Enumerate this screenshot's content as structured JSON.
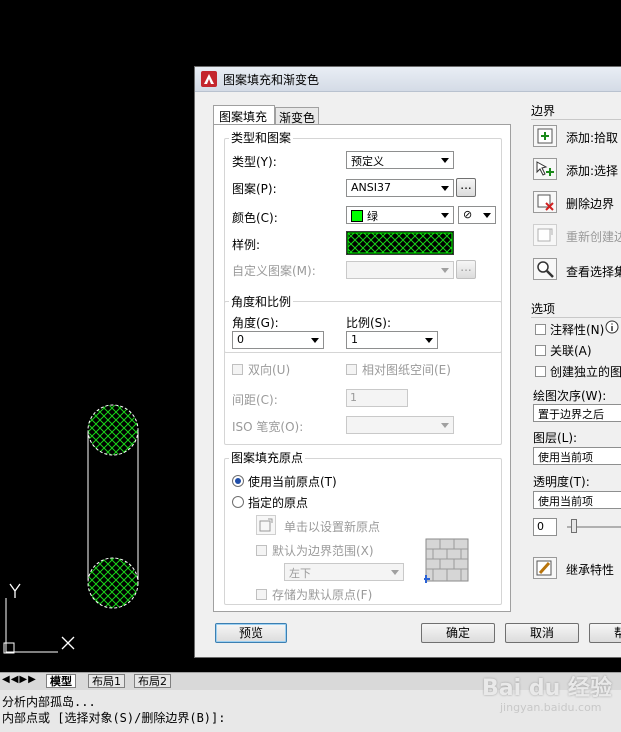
{
  "dialog": {
    "title": "图案填充和渐变色",
    "tabs": [
      "图案填充",
      "渐变色"
    ],
    "type_pattern": {
      "title": "类型和图案",
      "type_label": "类型(Y):",
      "type_value": "预定义",
      "pattern_label": "图案(P):",
      "pattern_value": "ANSI37",
      "browse": "...",
      "color_label": "颜色(C):",
      "color_value": "绿",
      "color_swatch": "#00ff00",
      "bgcolor_value": "⊘",
      "swatch_label": "样例:",
      "custom_label": "自定义图案(M):"
    },
    "angle_scale": {
      "title": "角度和比例",
      "angle_label": "角度(G):",
      "angle_value": "0",
      "scale_label": "比例(S):",
      "scale_value": "1",
      "double_label": "双向(U)",
      "relative_label": "相对图纸空间(E)",
      "spacing_label": "间距(C):",
      "spacing_value": "1",
      "iso_label": "ISO 笔宽(O):"
    },
    "origin": {
      "title": "图案填充原点",
      "current_label": "使用当前原点(T)",
      "specified_label": "指定的原点",
      "click_label": "单击以设置新原点",
      "default_extents_label": "默认为边界范围(X)",
      "position_value": "左下",
      "store_label": "存储为默认原点(F)"
    },
    "boundary": {
      "title": "边界",
      "add_pick": "添加:拾取",
      "add_select": "添加:选择",
      "remove": "删除边界",
      "recreate": "重新创建边",
      "view": "查看选择集"
    },
    "options": {
      "title": "选项",
      "annotative": "注释性(N)",
      "associative": "关联(A)",
      "separate": "创建独立的图",
      "draw_order_label": "绘图次序(W):",
      "draw_order_value": "置于边界之后",
      "layer_label": "图层(L):",
      "layer_value": "使用当前项",
      "transparency_label": "透明度(T):",
      "transparency_value": "使用当前项",
      "transparency_number": "0"
    },
    "inherit": "继承特性",
    "buttons": {
      "preview": "预览",
      "ok": "确定",
      "cancel": "取消",
      "help": "帮"
    }
  },
  "canvas": {
    "ucs_y": "Y",
    "ucs_x": "X"
  },
  "layout_tabs": [
    "模型",
    "布局1",
    "布局2"
  ],
  "command": {
    "line1": "分析内部孤岛...",
    "line2": "内部点或 [选择对象(S)/删除边界(B)]:"
  },
  "watermark": {
    "text": "Bai du 经验",
    "url": "jingyan.baidu.com"
  },
  "colors": {
    "hatch": "#00ff00",
    "ucs": "#ffffff"
  }
}
